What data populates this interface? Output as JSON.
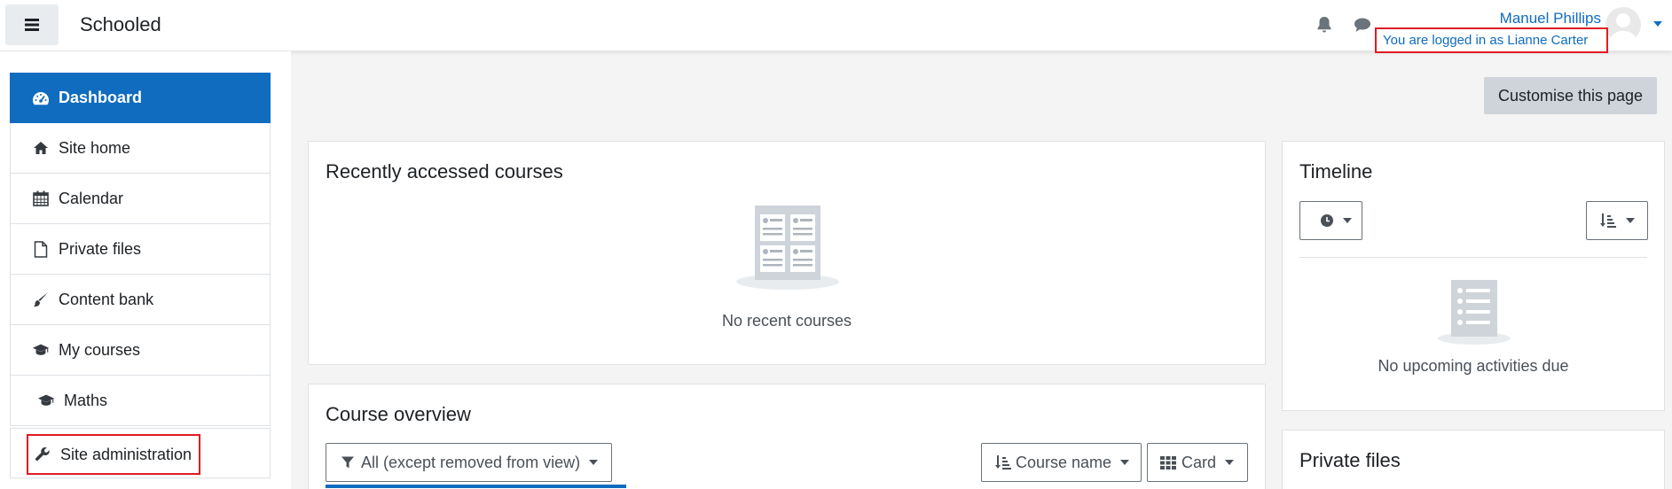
{
  "navbar": {
    "menu_icon": "hamburger-icon",
    "brand": "Schooled",
    "notifications_icon": "bell-icon",
    "messages_icon": "chat-bubble-icon",
    "user_name": "Manuel Phillips",
    "logged_in_as": "You are logged in as Lianne Carter",
    "avatar_icon": "user-avatar-icon"
  },
  "nav": {
    "items": [
      {
        "label": "Dashboard",
        "icon": "tachometer-icon"
      },
      {
        "label": "Site home",
        "icon": "home-icon"
      },
      {
        "label": "Calendar",
        "icon": "calendar-icon"
      },
      {
        "label": "Private files",
        "icon": "file-icon"
      },
      {
        "label": "Content bank",
        "icon": "paintbrush-icon"
      },
      {
        "label": "My courses",
        "icon": "graduation-cap-icon"
      },
      {
        "label": "Maths",
        "icon": "graduation-cap-icon"
      }
    ],
    "site_admin": {
      "label": "Site administration",
      "icon": "wrench-icon"
    }
  },
  "main": {
    "customise_label": "Customise this page",
    "recent": {
      "title": "Recently accessed courses",
      "empty": "No recent courses"
    },
    "overview": {
      "title": "Course overview",
      "filter_label": "All (except removed from view)",
      "sort_label": "Course name",
      "view_label": "Card"
    },
    "timeline": {
      "title": "Timeline",
      "empty": "No upcoming activities due"
    },
    "private_files": {
      "title": "Private files"
    }
  },
  "colors": {
    "primary": "#0f6cbf",
    "highlight": "#e01b24",
    "page_bg": "#f4f4f4"
  }
}
